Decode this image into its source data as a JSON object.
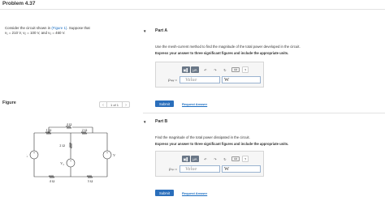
{
  "problem": {
    "title": "Problem 4.37"
  },
  "intro": {
    "line1_pre": "Consider the circuit shown in ",
    "line1_link": "(Figure 1)",
    "line1_post": ". Suppose that",
    "line2": "v₁ = 210 V, v₂ = 100 V, and v₃ = 460 V."
  },
  "figure": {
    "label": "Figure",
    "pager": {
      "prev": "<",
      "count": "1 of 1",
      "next": ">"
    }
  },
  "circuit": {
    "r_top": "4 Ω",
    "r_left": "1 Ω",
    "r_mid": "2 Ω",
    "r_center": "2 Ω",
    "r_bl": "4 Ω",
    "r_br": "3 Ω",
    "v1": "V₁",
    "v2": "V₂",
    "v3": "V₃"
  },
  "part_a": {
    "title": "Part A",
    "question": "Use the mesh-current method to find the magnitude of the total power developed in the circuit.",
    "instruction": "Express your answer to three significant figures and include the appropriate units.",
    "variable": "pₙₑᵥ =",
    "value_placeholder": "Value",
    "unit_value": "W",
    "submit": "Submit",
    "request": "Request Answer"
  },
  "part_b": {
    "title": "Part B",
    "question": "Find the magnitude of the total power dissipated in the circuit.",
    "instruction": "Express your answer to three significant figures and include the appropriate units.",
    "variable": "pₙᵢₛ =",
    "value_placeholder": "Value",
    "unit_value": "W",
    "submit": "Submit",
    "request": "Request Answer"
  },
  "toolbar": {
    "templates": "▣▌",
    "mu": "μA",
    "undo": "↶",
    "redo": "↷",
    "reset": "↻",
    "keyboard": "⌨",
    "help": "?"
  },
  "colors": {
    "accent": "#2a6ebb",
    "link": "#1b6ec2",
    "toolbar": "#6a7787"
  }
}
